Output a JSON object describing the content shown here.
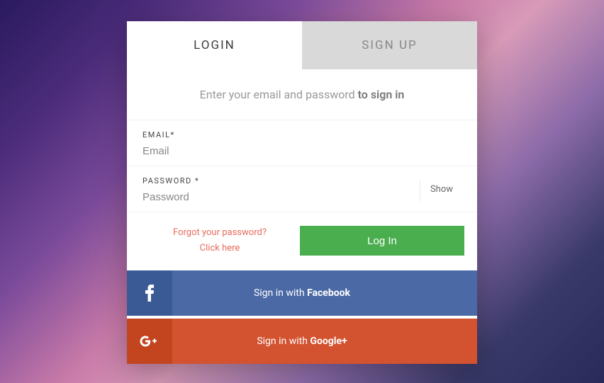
{
  "tabs": {
    "login": "LOGIN",
    "signup": "SIGN UP"
  },
  "prompt": {
    "prefix": "Enter your email and password ",
    "bold": "to sign in"
  },
  "fields": {
    "email": {
      "label": "EMAIL*",
      "placeholder": "Email"
    },
    "password": {
      "label": "PASSWORD *",
      "placeholder": "Password",
      "show_toggle": "Show"
    }
  },
  "forgot": {
    "line1": "Forgot your password?",
    "line2": "Click here"
  },
  "login_button": "Log In",
  "social": {
    "facebook": {
      "prefix": "Sign in with ",
      "brand": "Facebook"
    },
    "google": {
      "prefix": "Sign in with ",
      "brand": "Google+"
    }
  }
}
